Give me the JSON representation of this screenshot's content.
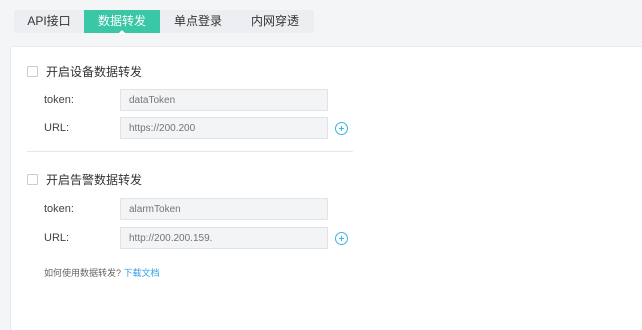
{
  "tabs": [
    {
      "label": "API接口"
    },
    {
      "label": "数据转发"
    },
    {
      "label": "单点登录"
    },
    {
      "label": "内网穿透"
    }
  ],
  "active_tab": "数据转发",
  "device_forwarding": {
    "title": "开启设备数据转发",
    "checked": false,
    "token_label": "token:",
    "token_placeholder": "dataToken",
    "url_label": "URL:",
    "url_placeholder": "https://200.200"
  },
  "alarm_forwarding": {
    "title": "开启告警数据转发",
    "checked": false,
    "token_label": "token:",
    "token_placeholder": "alarmToken",
    "url_label": "URL:",
    "url_placeholder": "http://200.200.159."
  },
  "help": {
    "question": "如何使用数据转发?",
    "link": "下载文档"
  },
  "colors": {
    "accent": "#3ac7a6",
    "link": "#2f9ee8",
    "add_icon": "#3cb4e6"
  },
  "icons": [
    "checkbox-icon",
    "add-circle-icon"
  ]
}
